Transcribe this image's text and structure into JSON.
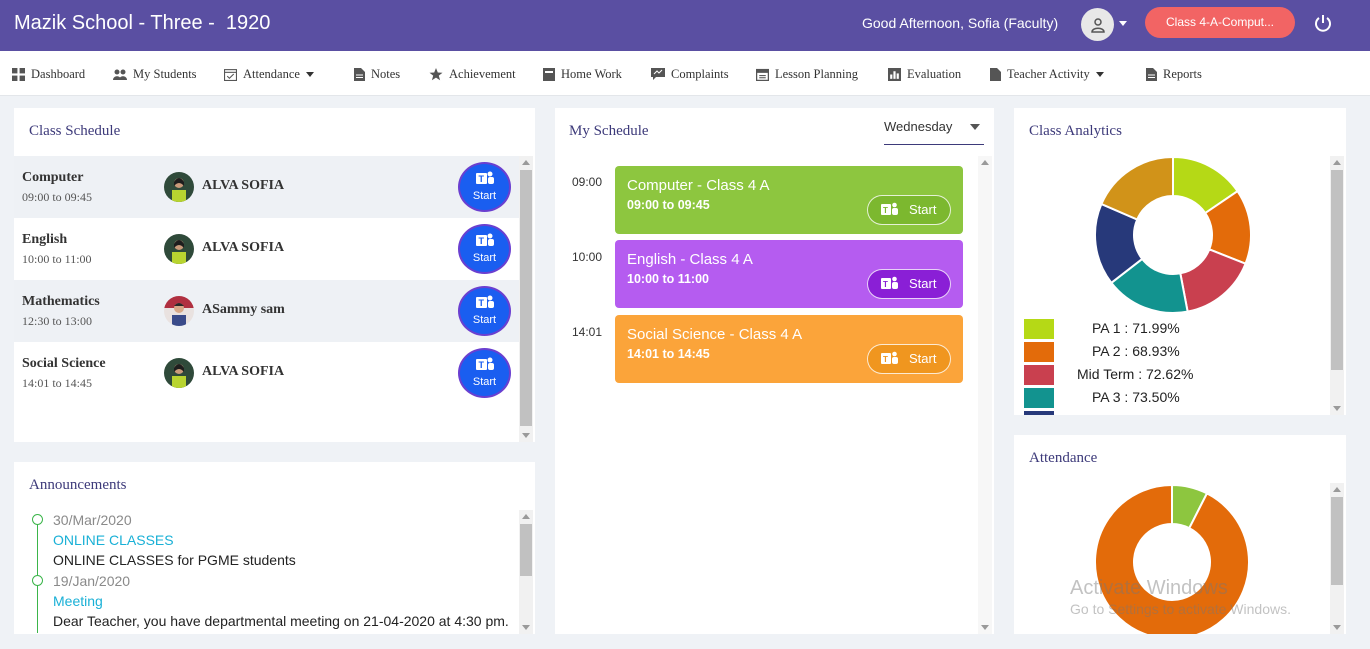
{
  "header": {
    "title": "Mazik School - Three -  1920",
    "greeting": "Good Afternoon, Sofia (Faculty)",
    "class_selector": "Class 4-A-Comput..."
  },
  "nav": [
    {
      "label": "Dashboard",
      "icon": "grid-icon"
    },
    {
      "label": "My Students",
      "icon": "users-icon"
    },
    {
      "label": "Attendance",
      "icon": "calendar-check-icon",
      "dropdown": true
    },
    {
      "label": "Notes",
      "icon": "file-icon"
    },
    {
      "label": "Achievement",
      "icon": "star-icon"
    },
    {
      "label": "Home Work",
      "icon": "book-icon"
    },
    {
      "label": "Complaints",
      "icon": "complaint-icon"
    },
    {
      "label": "Lesson Planning",
      "icon": "calendar-icon"
    },
    {
      "label": "Evaluation",
      "icon": "bar-chart-icon"
    },
    {
      "label": "Teacher Activity",
      "icon": "file-icon",
      "dropdown": true
    },
    {
      "label": "Reports",
      "icon": "report-icon"
    }
  ],
  "class_schedule": {
    "title": "Class Schedule",
    "rows": [
      {
        "subject": "Computer",
        "time": "09:00 to 09:45",
        "teacher": "ALVA SOFIA",
        "button": "Start"
      },
      {
        "subject": "English",
        "time": "10:00 to 11:00",
        "teacher": "ALVA SOFIA",
        "button": "Start"
      },
      {
        "subject": "Mathematics",
        "time": "12:30 to 13:00",
        "teacher": "ASammy sam",
        "button": "Start"
      },
      {
        "subject": "Social Science",
        "time": "14:01 to 14:45",
        "teacher": "ALVA SOFIA",
        "button": "Start"
      }
    ]
  },
  "my_schedule": {
    "title": "My Schedule",
    "day": "Wednesday",
    "events": [
      {
        "hour": "09:00",
        "title": "Computer - Class 4 A",
        "time": "09:00 to 09:45",
        "button": "Start",
        "color": "#8dc63f"
      },
      {
        "hour": "10:00",
        "title": "English - Class 4 A",
        "time": "10:00 to 11:00",
        "button": "Start",
        "color": "#b55cf0"
      },
      {
        "hour": "14:01",
        "title": "Social Science - Class 4 A",
        "time": "14:01 to 14:45",
        "button": "Start",
        "color": "#fba43a"
      }
    ]
  },
  "announcements": {
    "title": "Announcements",
    "items": [
      {
        "date": "30/Mar/2020",
        "heading": "ONLINE CLASSES",
        "body": "ONLINE CLASSES for PGME students"
      },
      {
        "date": "19/Jan/2020",
        "heading": "Meeting",
        "body": "Dear Teacher, you have departmental meeting on 21-04-2020 at 4:30 pm."
      }
    ]
  },
  "class_analytics": {
    "title": "Class Analytics",
    "legend": [
      {
        "label": "PA 1 : 71.99%",
        "color": "#b5d916"
      },
      {
        "label": "PA 2 : 68.93%",
        "color": "#e36b0a"
      },
      {
        "label": "Mid Term : 72.62%",
        "color": "#c9404f"
      },
      {
        "label": "PA 3 : 73.50%",
        "color": "#12938f"
      }
    ],
    "slice_colors": [
      "#b5d916",
      "#e36b0a",
      "#c9404f",
      "#12938f",
      "#27397a",
      "#d19319"
    ]
  },
  "attendance": {
    "title": "Attendance",
    "colors": {
      "present": "#8dc63f",
      "absent": "#e36b0a"
    }
  },
  "watermark": {
    "line1": "Activate Windows",
    "line2": "Go to Settings to activate Windows."
  }
}
